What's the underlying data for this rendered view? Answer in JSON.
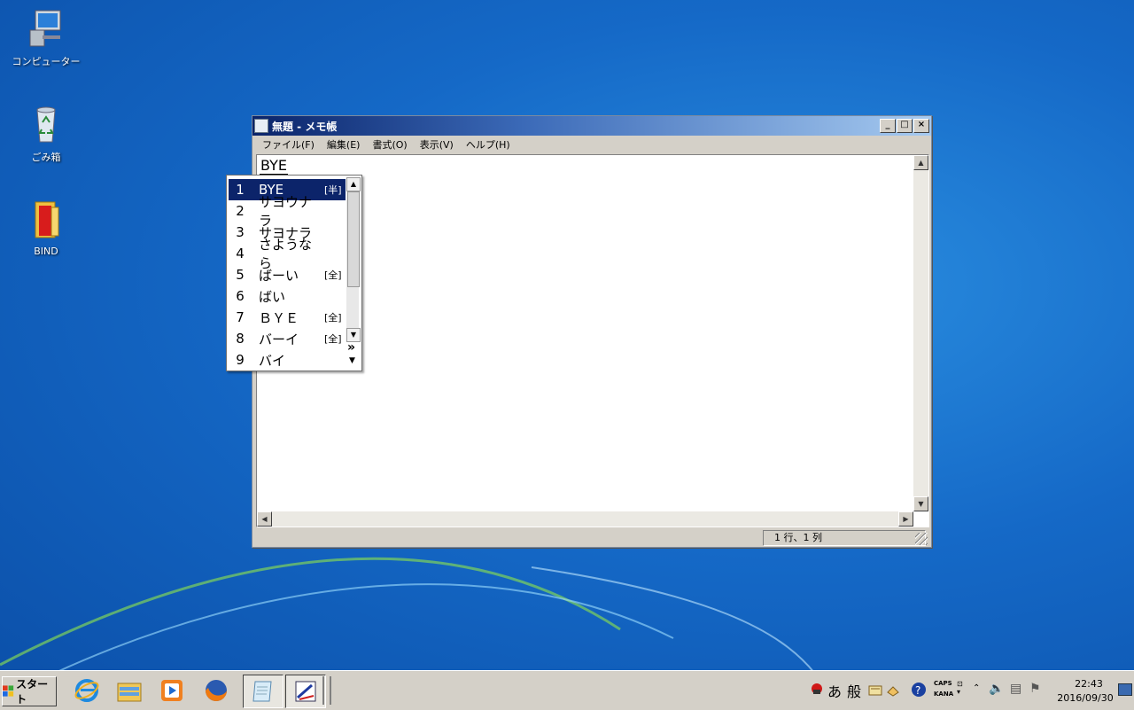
{
  "desktop": {
    "icons": [
      {
        "label": "コンピューター"
      },
      {
        "label": "ごみ箱"
      },
      {
        "label": "BIND"
      }
    ]
  },
  "notepad": {
    "title": "無題 - メモ帳",
    "menu": [
      "ファイル(F)",
      "編集(E)",
      "書式(O)",
      "表示(V)",
      "ヘルプ(H)"
    ],
    "text": "BYE",
    "status": "1 行、1 列"
  },
  "ime_candidates": [
    {
      "num": "1",
      "word": "BYE",
      "tag": "[半]",
      "selected": true
    },
    {
      "num": "2",
      "word": "サヨウナラ",
      "tag": ""
    },
    {
      "num": "3",
      "word": "サヨナラ",
      "tag": ""
    },
    {
      "num": "4",
      "word": "さようなら",
      "tag": ""
    },
    {
      "num": "5",
      "word": "ばーい",
      "tag": "[全]"
    },
    {
      "num": "6",
      "word": "ばい",
      "tag": ""
    },
    {
      "num": "7",
      "word": "ＢＹＥ",
      "tag": "[全]"
    },
    {
      "num": "8",
      "word": "バーイ",
      "tag": "[全]"
    },
    {
      "num": "9",
      "word": "バイ",
      "tag": ""
    }
  ],
  "ime_more": "»",
  "taskbar": {
    "start_label": "スタート",
    "ime_mode": "あ",
    "ime_conv": "般",
    "caps": "CAPS",
    "kana": "KANA",
    "time": "22:43",
    "date": "2016/09/30"
  }
}
